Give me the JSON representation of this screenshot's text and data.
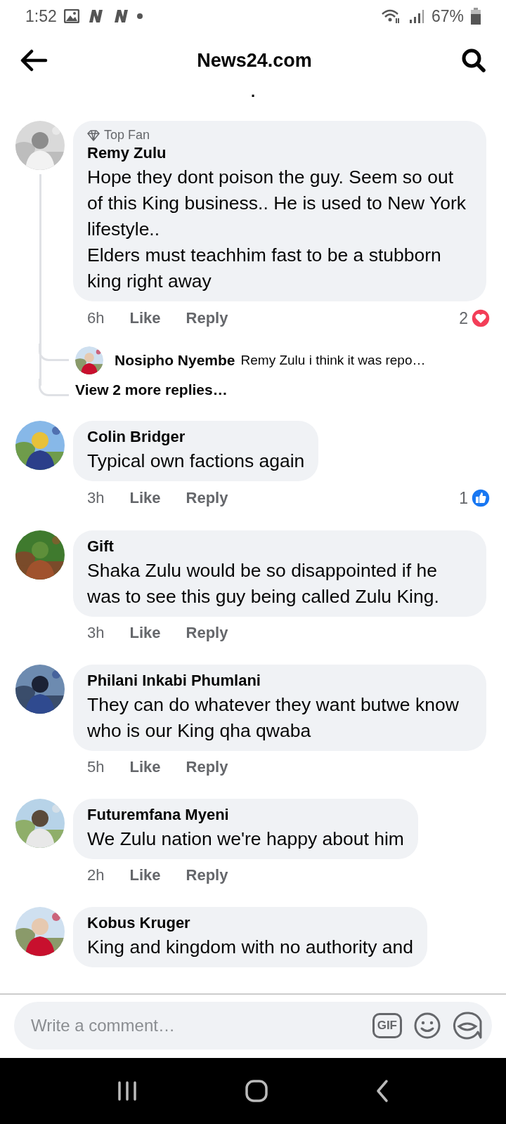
{
  "status_bar": {
    "time": "1:52",
    "battery": "67%"
  },
  "header": {
    "title": "News24.com",
    "fragment": "."
  },
  "comments": [
    {
      "author": "Remy Zulu",
      "badge": "Top Fan",
      "text": "Hope they dont poison the guy. Seem so out of this King business.. He is used to New York lifestyle..\nElders must teachhim fast to be a stubborn king right away",
      "time": "6h",
      "actions": [
        "Like",
        "Reply"
      ],
      "reaction": {
        "count": "2",
        "kind": "love"
      },
      "replies": [
        {
          "author": "Nosipho Nyembe",
          "text": "Remy Zulu i think it was repo…"
        }
      ],
      "more_replies": "View 2 more replies…"
    },
    {
      "author": "Colin Bridger",
      "text": "Typical own factions again",
      "time": "3h",
      "actions": [
        "Like",
        "Reply"
      ],
      "reaction": {
        "count": "1",
        "kind": "like"
      }
    },
    {
      "author": "Gift",
      "text": "Shaka Zulu would be so disappointed if he was to see this guy being called Zulu King.",
      "time": "3h",
      "actions": [
        "Like",
        "Reply"
      ]
    },
    {
      "author": "Philani Inkabi Phumlani",
      "text": "They can do whatever they want butwe know who is our King qha qwaba",
      "time": "5h",
      "actions": [
        "Like",
        "Reply"
      ]
    },
    {
      "author": "Futuremfana Myeni",
      "text": "We Zulu nation we're happy about him",
      "time": "2h",
      "actions": [
        "Like",
        "Reply"
      ]
    },
    {
      "author": "Kobus Kruger",
      "text": "King and kingdom with no authority and"
    }
  ],
  "composer": {
    "placeholder": "Write a comment…",
    "gif_label": "GIF"
  }
}
